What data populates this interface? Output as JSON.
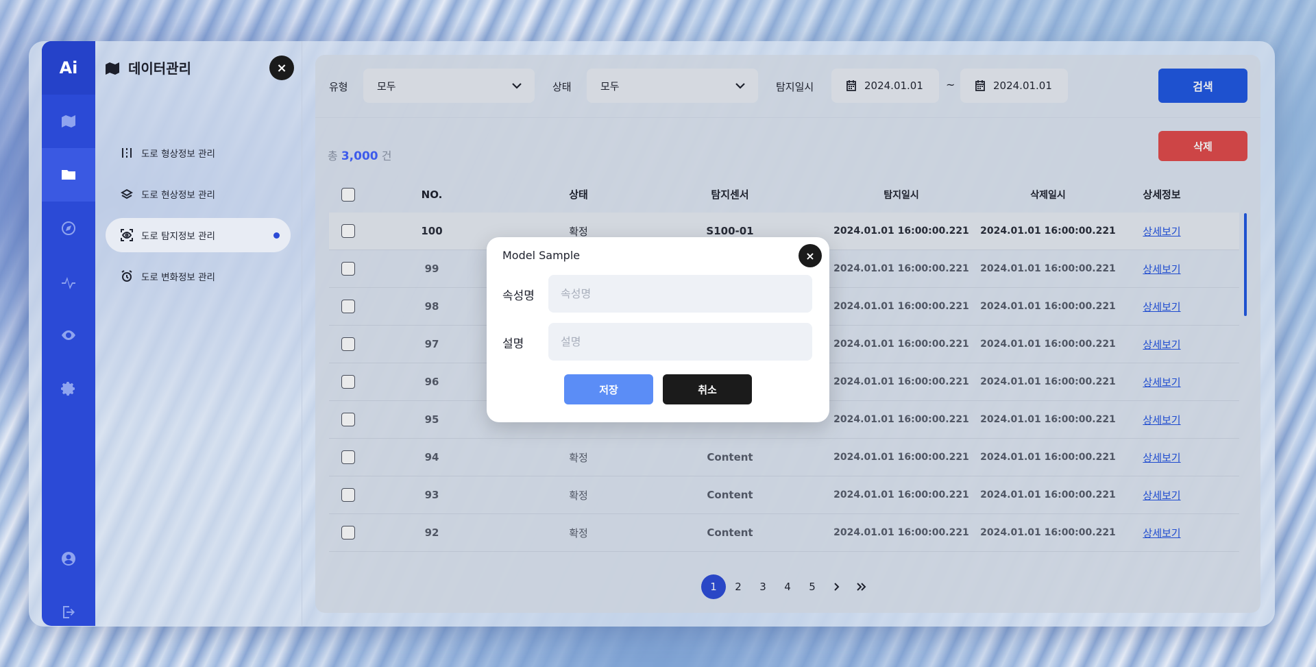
{
  "app": {
    "logo": "Ai"
  },
  "rail_icons": [
    {
      "name": "map-icon",
      "active": false
    },
    {
      "name": "folder-icon",
      "active": true
    },
    {
      "name": "compass-icon",
      "active": false
    },
    {
      "name": "activity-icon",
      "active": false
    },
    {
      "name": "eye-icon",
      "active": false
    },
    {
      "name": "gear-icon",
      "active": false
    },
    {
      "name": "user-icon",
      "active": false
    },
    {
      "name": "logout-icon",
      "active": false
    }
  ],
  "sidebar": {
    "title": "데이터관리",
    "close_label": "×",
    "items": [
      {
        "label": "도로 형상정보 관리",
        "active": false
      },
      {
        "label": "도로 현상정보 관리",
        "active": false
      },
      {
        "label": "도로 탐지정보 관리",
        "active": true
      },
      {
        "label": "도로 변화정보 관리",
        "active": false
      }
    ]
  },
  "filters": {
    "type_label": "유형",
    "type_value": "모두",
    "status_label": "상태",
    "status_value": "모두",
    "date_label": "탐지일시",
    "date_from": "2024.01.01",
    "date_sep": "~",
    "date_to": "2024.01.01",
    "search_label": "검색"
  },
  "summary": {
    "prefix": "총",
    "count": "3,000",
    "suffix": "건"
  },
  "delete_label": "삭제",
  "table": {
    "headers": [
      "NO.",
      "상태",
      "탐지센서",
      "탐지일시",
      "삭제일시",
      "상세정보"
    ],
    "rows": [
      {
        "no": "100",
        "status": "확정",
        "sensor": "S100-01",
        "detected": "2024.01.01 16:00:00.221",
        "deleted": "2024.01.01 16:00:00.221",
        "detail": "상세보기"
      },
      {
        "no": "99",
        "status": "",
        "sensor": "",
        "detected": "2024.01.01 16:00:00.221",
        "deleted": "2024.01.01 16:00:00.221",
        "detail": "상세보기"
      },
      {
        "no": "98",
        "status": "",
        "sensor": "",
        "detected": "2024.01.01 16:00:00.221",
        "deleted": "2024.01.01 16:00:00.221",
        "detail": "상세보기"
      },
      {
        "no": "97",
        "status": "",
        "sensor": "",
        "detected": "2024.01.01 16:00:00.221",
        "deleted": "2024.01.01 16:00:00.221",
        "detail": "상세보기"
      },
      {
        "no": "96",
        "status": "",
        "sensor": "",
        "detected": "2024.01.01 16:00:00.221",
        "deleted": "2024.01.01 16:00:00.221",
        "detail": "상세보기"
      },
      {
        "no": "95",
        "status": "",
        "sensor": "",
        "detected": "2024.01.01 16:00:00.221",
        "deleted": "2024.01.01 16:00:00.221",
        "detail": "상세보기"
      },
      {
        "no": "94",
        "status": "확정",
        "sensor": "Content",
        "detected": "2024.01.01 16:00:00.221",
        "deleted": "2024.01.01 16:00:00.221",
        "detail": "상세보기"
      },
      {
        "no": "93",
        "status": "확정",
        "sensor": "Content",
        "detected": "2024.01.01 16:00:00.221",
        "deleted": "2024.01.01 16:00:00.221",
        "detail": "상세보기"
      },
      {
        "no": "92",
        "status": "확정",
        "sensor": "Content",
        "detected": "2024.01.01 16:00:00.221",
        "deleted": "2024.01.01 16:00:00.221",
        "detail": "상세보기"
      }
    ]
  },
  "pagination": {
    "pages": [
      "1",
      "2",
      "3",
      "4",
      "5"
    ],
    "current": "1",
    "next": "›",
    "last": "»"
  },
  "modal": {
    "title": "Model Sample",
    "close_label": "×",
    "field1_label": "속성명",
    "field1_placeholder": "속성명",
    "field2_label": "설명",
    "field2_placeholder": "설명",
    "save_label": "저장",
    "cancel_label": "취소"
  },
  "colors": {
    "primary": "#2b4ad6",
    "search": "#1e55e0",
    "danger": "#e04848",
    "save": "#5b8df6"
  }
}
